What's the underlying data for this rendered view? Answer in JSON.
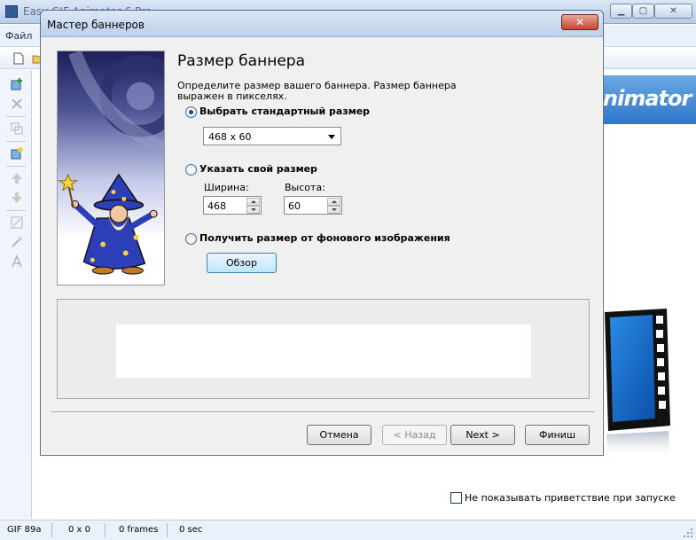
{
  "main_window": {
    "title": "Easy GIF Animator 6 Pro",
    "menu_file": "Файл",
    "banner_text": "nimator"
  },
  "welcome": {
    "dont_show_label": "Не показывать приветствие при запуске"
  },
  "statusbar": {
    "format": "GIF 89a",
    "dimensions": "0 x 0",
    "frames": "0 frames",
    "duration": "0 sec"
  },
  "wizard": {
    "title": "Мастер баннеров",
    "close_glyph": "✕",
    "heading": "Размер баннера",
    "description": "Определите размер вашего баннера. Размер баннера выражен в пикселях.",
    "options": {
      "standard": {
        "label": "Выбрать стандартный размер",
        "checked": true
      },
      "custom": {
        "label": "Указать свой размер",
        "checked": false
      },
      "from_bg": {
        "label": "Получить размер от фонового изображения",
        "checked": false
      }
    },
    "standard_size_value": "468 x 60",
    "width_label": "Ширина:",
    "width_value": "468",
    "height_label": "Высота:",
    "height_value": "60",
    "browse_label": "Обзор",
    "buttons": {
      "cancel": "Отмена",
      "back": "< Назад",
      "next": "Next >",
      "finish": "Финиш"
    }
  },
  "colors": {
    "accent": "#1b4d86",
    "close_red": "#c64534"
  }
}
